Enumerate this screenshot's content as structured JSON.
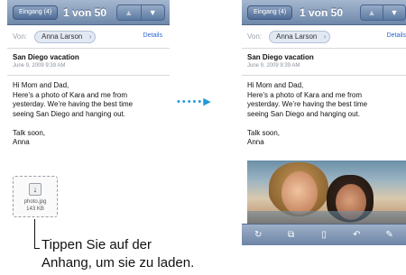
{
  "left_screen": {
    "back_label": "Eingang (4)",
    "title": "1 von 50",
    "up_icon": "up-arrow-icon",
    "down_icon": "down-arrow-icon",
    "from_label": "Von:",
    "from_name": "Anna Larson",
    "details_label": "Details",
    "subject": "San Diego vacation",
    "date": "June 9, 2009 9:39 AM",
    "body_lines": [
      "Hi Mom and Dad,",
      "Here’s a photo of Kara and me from",
      "yesterday. We’re having the best time",
      "seeing San Diego and hanging out.",
      "",
      "Talk soon,",
      "Anna"
    ],
    "attachment": {
      "icon": "download-arrow-icon",
      "name": "photo.jpg",
      "size": "143 KB"
    }
  },
  "right_screen": {
    "back_label": "Eingang (4)",
    "title": "1 von 50",
    "up_icon": "up-arrow-icon",
    "down_icon": "down-arrow-icon",
    "from_label": "Von:",
    "from_name": "Anna Larson",
    "details_label": "Details",
    "subject": "San Diego vacation",
    "date": "June 9, 2009 9:39 AM",
    "body_lines": [
      "Hi Mom and Dad,",
      "Here’s a photo of Kara and me from",
      "yesterday. We’re having the best time",
      "seeing San Diego and hanging out.",
      "",
      "Talk soon,",
      "Anna"
    ],
    "toolbar_icons": [
      "refresh-icon",
      "move-folder-icon",
      "trash-icon",
      "reply-icon",
      "compose-icon"
    ]
  },
  "transition_arrow_icon": "dotted-right-arrow-icon",
  "caption_lines": [
    "Tippen Sie auf der",
    "Anhang, um sie zu laden."
  ]
}
